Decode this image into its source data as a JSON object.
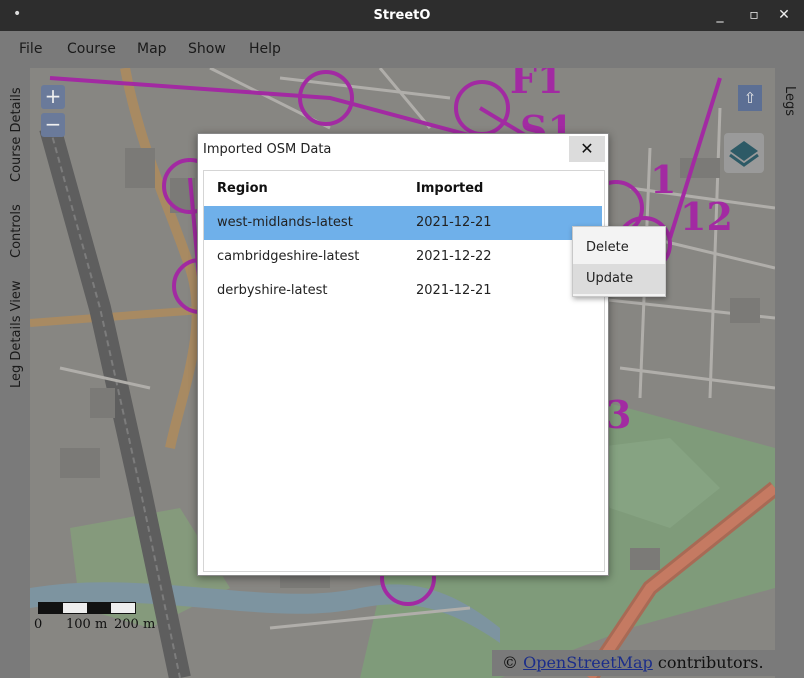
{
  "window": {
    "title": "StreetO",
    "menu_icon": "dot-menu-icon"
  },
  "menubar": {
    "items": [
      "File",
      "Course",
      "Map",
      "Show",
      "Help"
    ]
  },
  "left_tabs": [
    "Course Details",
    "Controls",
    "Leg Details View"
  ],
  "right_tabs": [
    "Legs"
  ],
  "map": {
    "zoom_in": "+",
    "zoom_out": "−",
    "scale_labels": [
      "0",
      "100 m",
      "200 m"
    ],
    "attribution_prefix": "© ",
    "attribution_link": "OpenStreetMap",
    "attribution_suffix": " contributors.",
    "course_labels": [
      "F1",
      "S1",
      "1",
      "12",
      "3"
    ],
    "colors": {
      "course": "#a22aa2",
      "park": "#8aa882",
      "road": "#b08a5a",
      "water": "#7d94a0"
    }
  },
  "dialog": {
    "title": "Imported OSM Data",
    "close": "✕",
    "columns": [
      "Region",
      "Imported"
    ],
    "rows": [
      {
        "region": "west-midlands-latest",
        "imported": "2021-12-21",
        "selected": true
      },
      {
        "region": "cambridgeshire-latest",
        "imported": "2021-12-22",
        "selected": false
      },
      {
        "region": "derbyshire-latest",
        "imported": "2021-12-21",
        "selected": false
      }
    ],
    "selection_color": "#6fb0ea"
  },
  "context_menu": {
    "items": [
      "Delete",
      "Update"
    ],
    "hovered": "Update"
  }
}
